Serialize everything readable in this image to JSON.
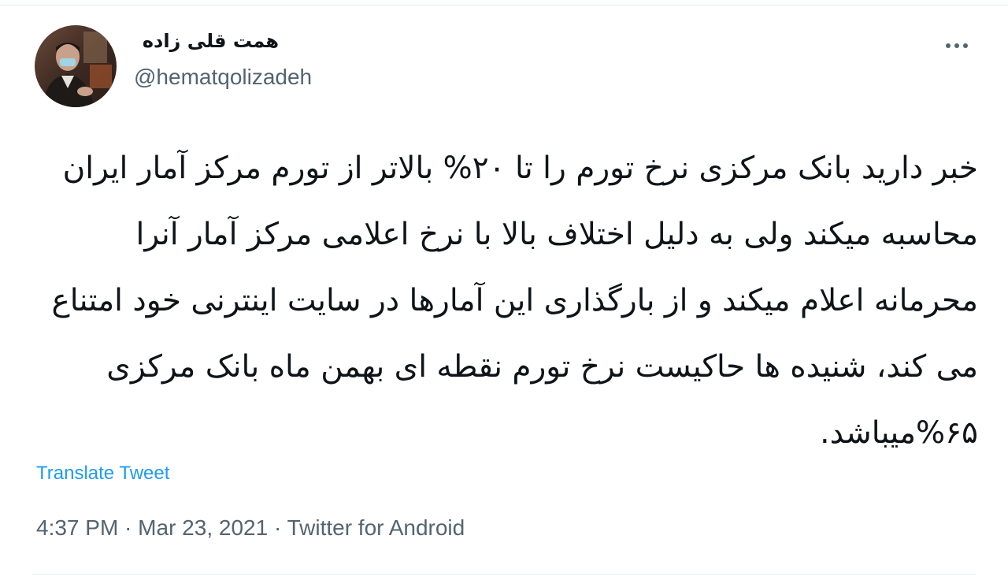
{
  "author": {
    "display_name": "همت قلی زاده",
    "handle": "@hematqolizadeh"
  },
  "more_icon": "more-horizontal-icon",
  "tweet": {
    "text": "خبر دارید بانک مرکزی نرخ تورم را تا ۲۰% بالاتر از تورم مرکز آمار ایران محاسبه میکند ولی به دلیل اختلاف بالا با نرخ اعلامی مرکز آمار آنرا محرمانه اعلام میکند و از بارگذاری این آمارها در سایت اینترنی خود امتناع می کند، شنیده ها حاکیست نرخ تورم نقطه ای بهمن ماه بانک مرکزی ۶۵%میباشد.",
    "translate_label": "Translate Tweet",
    "time": "4:37 PM",
    "date": "Mar 23, 2021",
    "source": "Twitter for Android",
    "separator": " · "
  },
  "colors": {
    "text_primary": "#0f1419",
    "text_secondary": "#536471",
    "link": "#1d9bf0",
    "border": "#e6ecf0"
  }
}
